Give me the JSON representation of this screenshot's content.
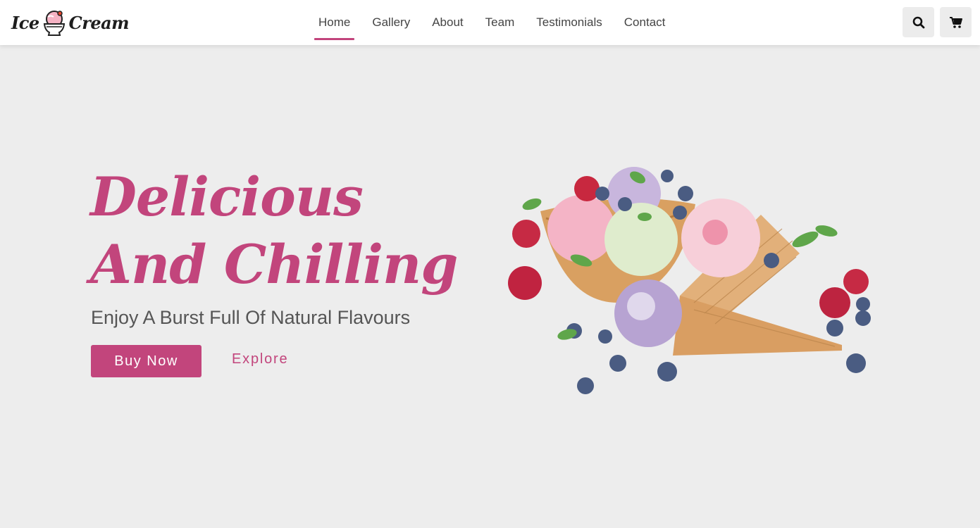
{
  "brand": {
    "logo_word_1": "Ice",
    "logo_word_2": "Cream",
    "logo_icon": "ice-cream-cup-icon"
  },
  "nav": {
    "items": [
      {
        "label": "Home",
        "active": true
      },
      {
        "label": "Gallery",
        "active": false
      },
      {
        "label": "About",
        "active": false
      },
      {
        "label": "Team",
        "active": false
      },
      {
        "label": "Testimonials",
        "active": false
      },
      {
        "label": "Contact",
        "active": false
      }
    ],
    "search_icon": "search-icon",
    "cart_icon": "cart-icon"
  },
  "hero": {
    "heading_line_1": "Delicious",
    "heading_line_2": "And Chilling",
    "subtitle": "Enjoy A Burst Full Of Natural Flavours",
    "primary_button": "Buy Now",
    "secondary_link": "Explore",
    "image": "ice-cream-cones-with-berries"
  },
  "colors": {
    "accent": "#c2457c",
    "background": "#ededed",
    "navbar": "#ffffff",
    "text": "#555555"
  }
}
